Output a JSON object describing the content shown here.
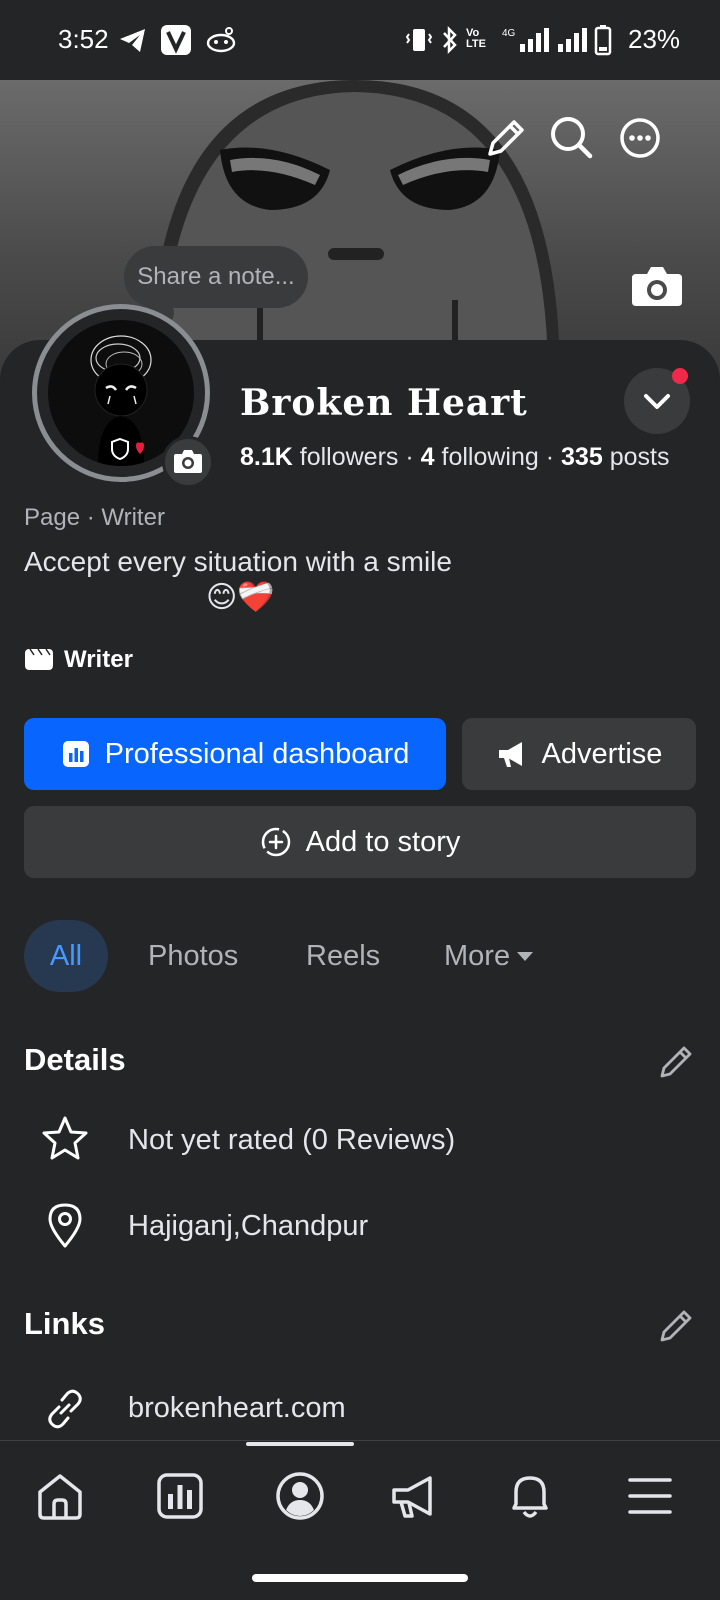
{
  "status_bar": {
    "time": "3:52",
    "battery": "23%",
    "network": "4G"
  },
  "note": {
    "placeholder": "Share a note..."
  },
  "profile": {
    "name": "Broken Heart",
    "followers_count": "8.1K",
    "followers_label": "followers",
    "following_count": "4",
    "following_label": "following",
    "posts_count": "335",
    "posts_label": "posts",
    "separator": "·",
    "page_category": "Page · Writer",
    "bio": "Accept every situation with a smile",
    "bio_emoji": "😊❤️‍🩹",
    "category_tag": "Writer"
  },
  "actions": {
    "professional_dashboard": "Professional dashboard",
    "advertise": "Advertise",
    "add_to_story": "Add to story"
  },
  "tabs": [
    {
      "label": "All",
      "active": true
    },
    {
      "label": "Photos",
      "active": false
    },
    {
      "label": "Reels",
      "active": false
    },
    {
      "label": "More",
      "active": false
    }
  ],
  "details": {
    "title": "Details",
    "rating": "Not yet rated (0 Reviews)",
    "location": "Hajiganj,Chandpur"
  },
  "links": {
    "title": "Links",
    "website": "brokenheart.com"
  },
  "bottom_nav": [
    "home-icon",
    "dashboard-icon",
    "profile-icon",
    "megaphone-icon",
    "bell-icon",
    "menu-icon"
  ],
  "colors": {
    "accent": "#0866ff",
    "background": "#242526",
    "surface": "#3a3b3c",
    "active_tab_bg": "#263951",
    "active_tab_text": "#4599ff",
    "notification_dot": "#f02849"
  }
}
